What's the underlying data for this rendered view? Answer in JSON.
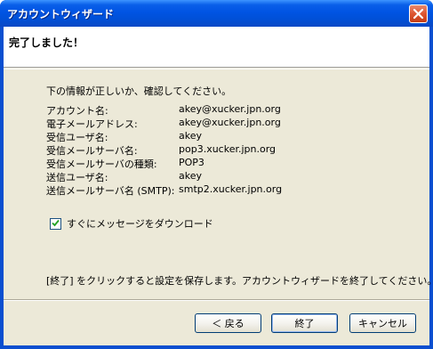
{
  "window": {
    "title": "アカウントウィザード"
  },
  "header": {
    "title": "完了しました！"
  },
  "intro_text": "下の情報が正しいか、確認してください。",
  "summary": [
    {
      "label": "アカウント名:",
      "value": "akey@xucker.jpn.org"
    },
    {
      "label": "電子メールアドレス:",
      "value": "akey@xucker.jpn.org"
    },
    {
      "label": "受信ユーザ名:",
      "value": "akey"
    },
    {
      "label": "受信メールサーバ名:",
      "value": "pop3.xucker.jpn.org"
    },
    {
      "label": "受信メールサーバの種類:",
      "value": "POP3"
    },
    {
      "label": "送信ユーザ名:",
      "value": "akey"
    },
    {
      "label": "送信メールサーバ名 (SMTP):",
      "value": "smtp2.xucker.jpn.org"
    }
  ],
  "download_checkbox": {
    "label": "すぐにメッセージをダウンロード",
    "checked": true
  },
  "finish_note": "[終了] をクリックすると設定を保存します。アカウントウィザードを終了してください。",
  "buttons": {
    "back": "＜ 戻る",
    "finish": "終了",
    "cancel": "キャンセル"
  },
  "icons": {
    "close": "close-icon",
    "check": "checkmark-icon"
  }
}
